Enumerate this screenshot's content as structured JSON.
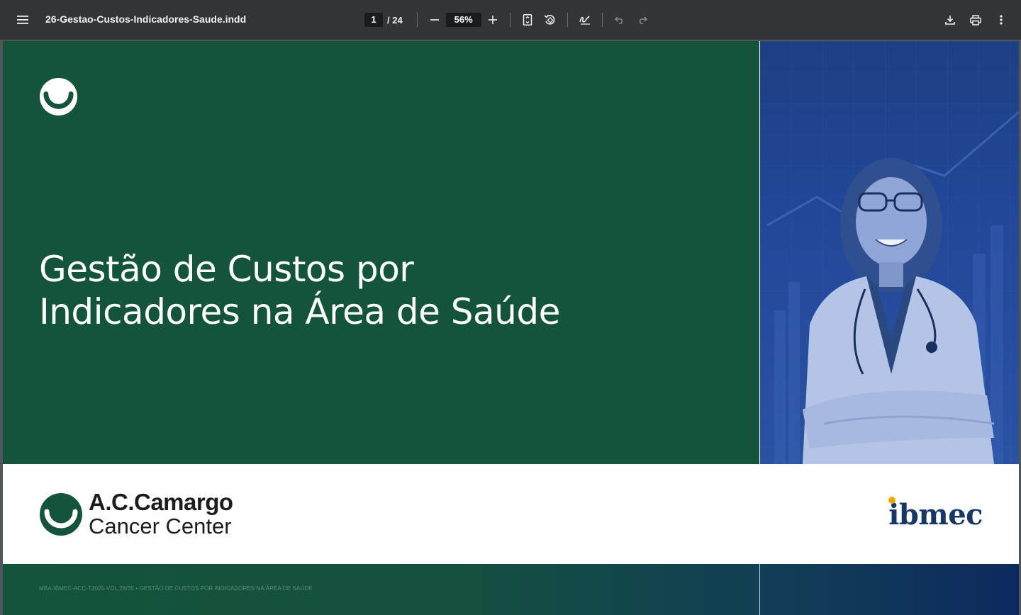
{
  "toolbar": {
    "title": "26-Gestao-Custos-Indicadores-Saude.indd",
    "current_page": "1",
    "total_pages": "/ 24",
    "zoom": "56%",
    "icons": [
      "menu-icon",
      "zoom-out-icon",
      "zoom-in-icon",
      "fit-page-icon",
      "rotate-icon",
      "annotate-icon",
      "undo-icon",
      "redo-icon",
      "download-icon",
      "print-icon",
      "more-icon"
    ]
  },
  "cover": {
    "title_line1": "Gestão de Custos por",
    "title_line2": "Indicadores na Área de Saúde",
    "acc_logo_name": "A.C.Camargo",
    "acc_logo_sub": "Cancer Center",
    "ibmec_logo": "ibmec",
    "footer_code": "MBA-IBMEC-ACC-T2025-VOL.26/35 • GESTÃO DE CUSTOS POR INDICADORES NA ÁREA DE SAÚDE"
  },
  "colors": {
    "toolbar_bg": "#323639",
    "viewer_bg": "#525659",
    "cover_green": "#13543a",
    "photo_blue": "#22489a",
    "ibmec_navy": "#173866",
    "ibmec_accent": "#f0a500"
  }
}
